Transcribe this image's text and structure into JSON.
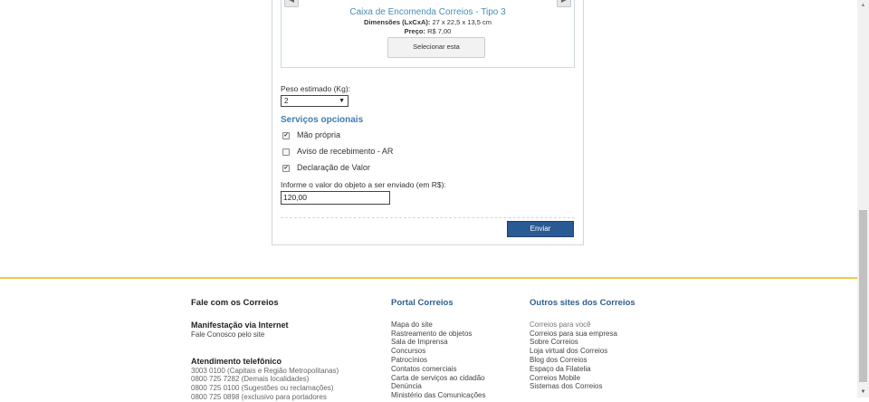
{
  "box": {
    "title": "Caixa de Encomenda Correios - Tipo 3",
    "dims_label": "Dimensões (LxCxA):",
    "dims_value": "27 x 22,5 x 13,5 cm",
    "price_label": "Preço:",
    "price_value": "R$ 7,00",
    "select_label": "Selecionar esta"
  },
  "weight": {
    "label": "Peso estimado (Kg):",
    "value": "2"
  },
  "optional": {
    "title": "Serviços opcionais",
    "items": [
      {
        "label": "Mão própria",
        "checked": true
      },
      {
        "label": "Aviso de recebimento - AR",
        "checked": false
      },
      {
        "label": "Declaração de Valor",
        "checked": true
      }
    ]
  },
  "declared": {
    "label": "Informe o valor do objeto a ser enviado (em R$):",
    "value": "120,00"
  },
  "send_label": "Enviar",
  "footer": {
    "col1": {
      "title": "Fale com os Correios",
      "internet_title": "Manifestação via Internet",
      "internet_link": "Fale Conosco pelo site",
      "phone_title": "Atendimento telefônico",
      "phones": [
        "3003 0100 (Capitais e Região Metropolitanas)",
        "0800 725 7282 (Demais localidades)",
        "0800 725 0100 (Sugestões ou reclamações)",
        "0800 725 0898 (exclusivo para portadores"
      ]
    },
    "col2": {
      "title": "Portal Correios",
      "links": [
        "Mapa do site",
        "Rastreamento de objetos",
        "Sala de Imprensa",
        "Concursos",
        "Patrocínios",
        "Contatos comerciais",
        "Carta de serviços ao cidadão",
        "Denúncia",
        "Ministério das Comunicações"
      ]
    },
    "col3": {
      "title": "Outros sites dos Correios",
      "links": [
        "Correios para você",
        "Correios para sua empresa",
        "Sobre Correios",
        "Loja virtual dos Correios",
        "Blog dos Correios",
        "Espaço da Filatelia",
        "Correios Mobile",
        "Sistemas dos Correios"
      ]
    }
  },
  "colors": {
    "accent_blue": "#2a5a93",
    "title_blue": "#4c8db4",
    "footer_line": "#f2c94c"
  }
}
